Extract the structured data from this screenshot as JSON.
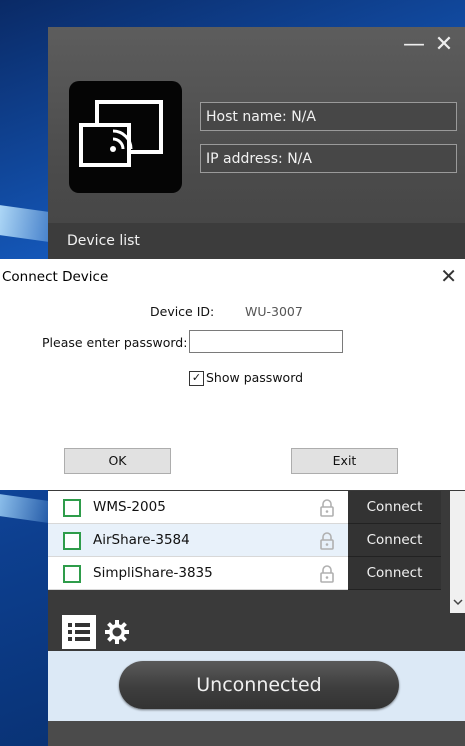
{
  "window": {
    "minimize": "—",
    "close": "✕"
  },
  "host_info": {
    "host_name": "Host name:  N/A",
    "ip_address": "IP address:  N/A"
  },
  "device_list_label": "Device list",
  "dialog": {
    "title": "Connect Device",
    "close": "✕",
    "device_id_label": "Device ID:",
    "device_id_value": "WU-3007",
    "password_label": "Please enter password:",
    "password_value": "",
    "show_password_label": "Show password",
    "show_password_checked": true,
    "ok_label": "OK",
    "exit_label": "Exit"
  },
  "devices": [
    {
      "name": "WMS-2005",
      "action": "Connect"
    },
    {
      "name": "AirShare-3584",
      "action": "Connect"
    },
    {
      "name": "SimpliShare-3835",
      "action": "Connect"
    }
  ],
  "status": "Unconnected",
  "colors": {
    "checkbox_green": "#2e9c4a",
    "header_gray": "#4b4b4b",
    "panel_light_blue": "#dce9f6"
  },
  "icons": [
    "cast-screen-icon",
    "lock-icon",
    "list-icon",
    "gear-icon",
    "chevron-down-icon"
  ]
}
